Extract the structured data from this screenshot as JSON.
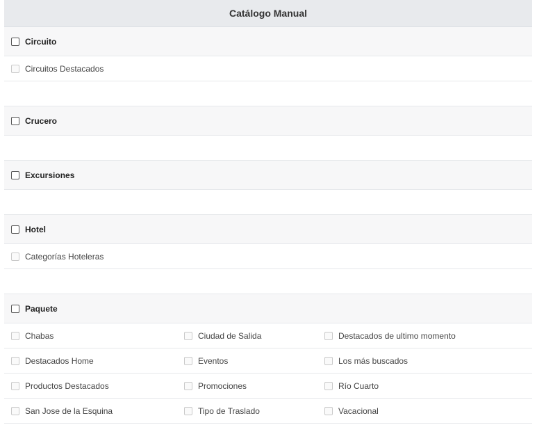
{
  "title": "Catálogo Manual",
  "sections": {
    "circuito": {
      "label": "Circuito",
      "items": [
        "Circuitos Destacados"
      ]
    },
    "crucero": {
      "label": "Crucero",
      "items": []
    },
    "excursiones": {
      "label": "Excursiones",
      "items": []
    },
    "hotel": {
      "label": "Hotel",
      "items": [
        "Categorías Hoteleras"
      ]
    },
    "paquete": {
      "label": "Paquete",
      "items": [
        "Chabas",
        "Ciudad de Salida",
        "Destacados de ultimo momento",
        "Destacados Home",
        "Eventos",
        "Los más buscados",
        "Productos Destacados",
        "Promociones",
        "Río Cuarto",
        "San Jose de la Esquina",
        "Tipo de Traslado",
        "Vacacional"
      ]
    }
  }
}
